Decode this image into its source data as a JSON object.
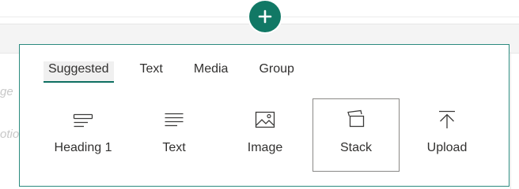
{
  "background": {
    "ghost_text_1": "ge",
    "ghost_text_2": "otio"
  },
  "add_button": {
    "icon": "plus-icon",
    "color": "#117865"
  },
  "tabs": [
    {
      "label": "Suggested",
      "active": true
    },
    {
      "label": "Text",
      "active": false
    },
    {
      "label": "Media",
      "active": false
    },
    {
      "label": "Group",
      "active": false
    }
  ],
  "tiles": [
    {
      "label": "Heading 1",
      "icon": "heading-icon",
      "selected": false
    },
    {
      "label": "Text",
      "icon": "text-lines-icon",
      "selected": false
    },
    {
      "label": "Image",
      "icon": "image-icon",
      "selected": false
    },
    {
      "label": "Stack",
      "icon": "stack-icon",
      "selected": true
    },
    {
      "label": "Upload",
      "icon": "upload-icon",
      "selected": false
    }
  ],
  "colors": {
    "accent": "#117865",
    "panel_border": "#2b8a7e",
    "tab_underline": "#0e6f61",
    "text": "#323130"
  }
}
